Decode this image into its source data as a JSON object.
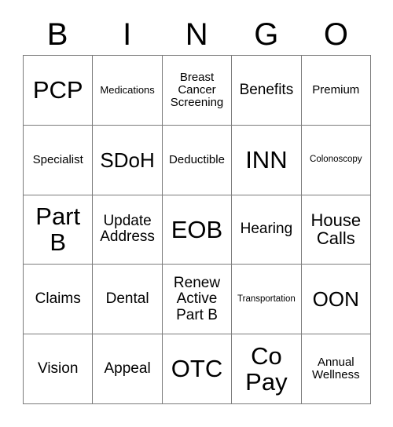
{
  "card": {
    "title": "BINGO",
    "header_letters": [
      "B",
      "I",
      "N",
      "G",
      "O"
    ],
    "border_color": "#7b7b7b",
    "background_color": "#ffffff",
    "text_color": "#000000",
    "columns": 5,
    "rows": 5,
    "cells": [
      {
        "text": "PCP",
        "size": "fs-xxl"
      },
      {
        "text": "Medications",
        "size": "fs-xs"
      },
      {
        "text": "Breast\nCancer\nScreening",
        "size": "fs-sm"
      },
      {
        "text": "Benefits",
        "size": "fs-md"
      },
      {
        "text": "Premium",
        "size": "fs-sm"
      },
      {
        "text": "Specialist",
        "size": "fs-sm"
      },
      {
        "text": "SDoH",
        "size": "fs-xl"
      },
      {
        "text": "Deductible",
        "size": "fs-sm"
      },
      {
        "text": "INN",
        "size": "fs-xxl"
      },
      {
        "text": "Colonoscopy",
        "size": "fs-xxs"
      },
      {
        "text": "Part\nB",
        "size": "fs-xxl"
      },
      {
        "text": "Update\nAddress",
        "size": "fs-md"
      },
      {
        "text": "EOB",
        "size": "fs-xxl"
      },
      {
        "text": "Hearing",
        "size": "fs-md"
      },
      {
        "text": "House\nCalls",
        "size": "fs-lg"
      },
      {
        "text": "Claims",
        "size": "fs-md"
      },
      {
        "text": "Dental",
        "size": "fs-md"
      },
      {
        "text": "Renew\nActive\nPart B",
        "size": "fs-md"
      },
      {
        "text": "Transportation",
        "size": "fs-xxs"
      },
      {
        "text": "OON",
        "size": "fs-xl"
      },
      {
        "text": "Vision",
        "size": "fs-md"
      },
      {
        "text": "Appeal",
        "size": "fs-md"
      },
      {
        "text": "OTC",
        "size": "fs-xxl"
      },
      {
        "text": "Co\nPay",
        "size": "fs-xxl"
      },
      {
        "text": "Annual\nWellness",
        "size": "fs-sm"
      }
    ]
  }
}
